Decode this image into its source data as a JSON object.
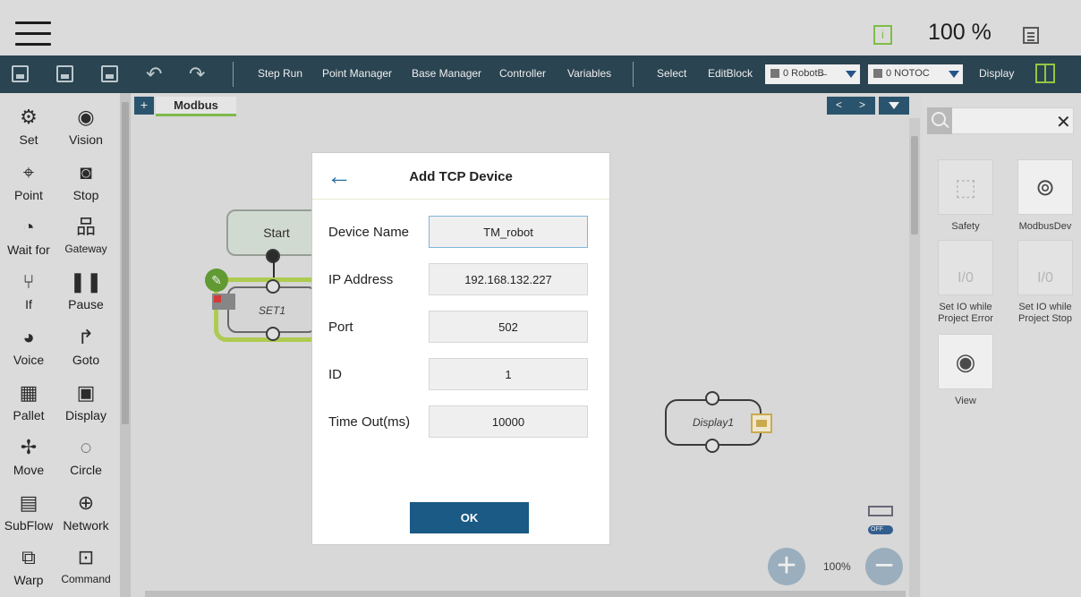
{
  "topbar": {
    "speed": "100 %",
    "info_glyph": "i"
  },
  "toolbar": {
    "buttons": [
      "Step Run",
      "Point Manager",
      "Base Manager",
      "Controller",
      "Variables",
      "Select",
      "EditBlock"
    ],
    "robot_base_select": "0 RobotB̶",
    "tool_select": "0 NOTOC",
    "display_label": "Display"
  },
  "palette": {
    "items": [
      {
        "label": "Set",
        "icon": "set-icon"
      },
      {
        "label": "Vision",
        "icon": "vision-icon"
      },
      {
        "label": "Point",
        "icon": "point-icon"
      },
      {
        "label": "Stop",
        "icon": "stop-icon"
      },
      {
        "label": "Wait for",
        "icon": "wait-for-icon"
      },
      {
        "label": "Gateway",
        "icon": "gateway-icon"
      },
      {
        "label": "If",
        "icon": "if-icon"
      },
      {
        "label": "Pause",
        "icon": "pause-icon"
      },
      {
        "label": "Voice",
        "icon": "voice-icon"
      },
      {
        "label": "Goto",
        "icon": "goto-icon"
      },
      {
        "label": "Pallet",
        "icon": "pallet-icon"
      },
      {
        "label": "Display",
        "icon": "display-icon"
      },
      {
        "label": "Move",
        "icon": "move-icon"
      },
      {
        "label": "Circle",
        "icon": "circle-icon"
      },
      {
        "label": "SubFlow",
        "icon": "subflow-icon"
      },
      {
        "label": "Network",
        "icon": "network-icon"
      },
      {
        "label": "Warp",
        "icon": "warp-icon"
      },
      {
        "label": "Command",
        "icon": "command-icon"
      }
    ]
  },
  "canvas": {
    "tab_add": "+",
    "active_tab": "Modbus",
    "nav_prev": "<",
    "nav_next": ">",
    "nodes": {
      "start": "Start",
      "set": "SET1",
      "display": "Display1"
    },
    "toggle_state": "OFF",
    "zoom": "100%"
  },
  "right_panel": {
    "search_value": "",
    "items": [
      {
        "label": "Safety",
        "icon": "safety-icon",
        "enabled": false
      },
      {
        "label": "ModbusDev",
        "icon": "modbus-device-icon",
        "enabled": true
      },
      {
        "label": "Set IO while Project Error",
        "icon": "io-error-icon",
        "enabled": false
      },
      {
        "label": "Set IO while Project Stop",
        "icon": "io-stop-icon",
        "enabled": false
      },
      {
        "label": "View",
        "icon": "view-icon",
        "enabled": true
      }
    ],
    "io_tile_glyph": "I/0"
  },
  "dialog": {
    "title": "Add TCP Device",
    "fields": [
      {
        "label": "Device Name",
        "value": "TM_robot"
      },
      {
        "label": "IP Address",
        "value": "192.168.132.227"
      },
      {
        "label": "Port",
        "value": "502"
      },
      {
        "label": "ID",
        "value": "1"
      },
      {
        "label": "Time Out(ms)",
        "value": "10000"
      }
    ],
    "ok_label": "OK"
  },
  "colors": {
    "toolbar_bg": "#1f3d4c",
    "accent_green": "#7cc242",
    "ok_button": "#1a5a84",
    "back_arrow": "#2a6fa0"
  }
}
